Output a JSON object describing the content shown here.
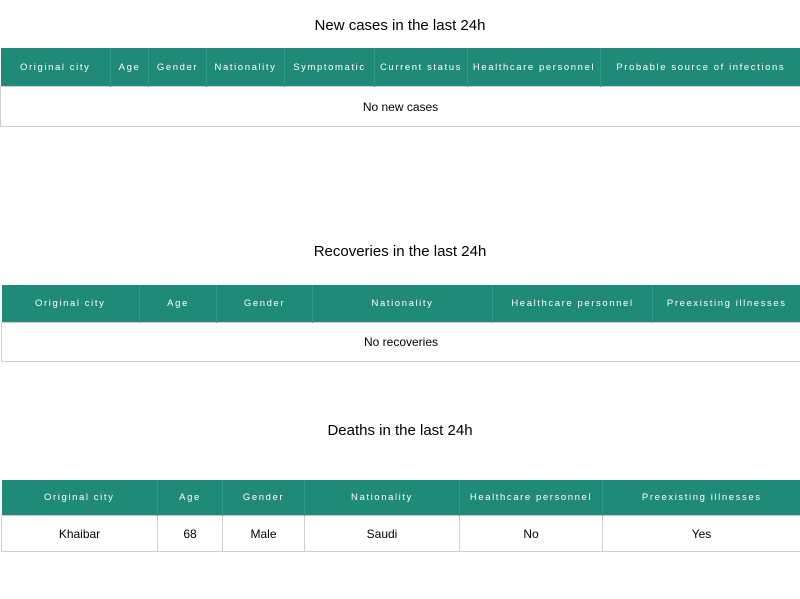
{
  "new_cases": {
    "title": "New cases in the last 24h",
    "columns": [
      "Original city",
      "Age",
      "Gender",
      "Nationality",
      "Symptomatic",
      "Current status",
      "Healthcare personnel",
      "Probable source of infections"
    ],
    "empty_text": "No new cases"
  },
  "recoveries": {
    "title": "Recoveries in the last 24h",
    "columns": [
      "Original city",
      "Age",
      "Gender",
      "Nationality",
      "Healthcare personnel",
      "Preexisting illnesses"
    ],
    "empty_text": "No recoveries"
  },
  "deaths": {
    "title": "Deaths in the last 24h",
    "columns": [
      "Original city",
      "Age",
      "Gender",
      "Nationality",
      "Healthcare personnel",
      "Preexisting illnesses"
    ],
    "rows": [
      [
        "Khaibar",
        "68",
        "Male",
        "Saudi",
        "No",
        "Yes"
      ]
    ]
  },
  "colors": {
    "header_bg": "#1f8a78",
    "header_text": "#ffffff",
    "border": "#cfcfcf"
  }
}
